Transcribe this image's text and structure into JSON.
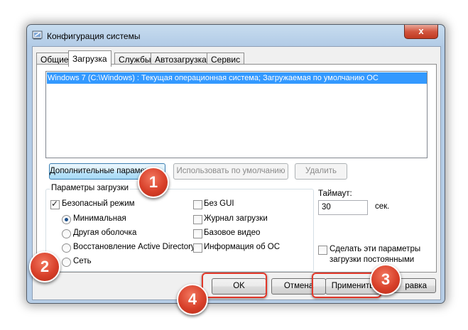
{
  "window": {
    "title": "Конфигурация системы",
    "close": "x"
  },
  "tabs": [
    {
      "label": "Общие"
    },
    {
      "label": "Загрузка"
    },
    {
      "label": "Службы"
    },
    {
      "label": "Автозагрузка"
    },
    {
      "label": "Сервис"
    }
  ],
  "os_list": {
    "entry": "Windows 7 (C:\\Windows) : Текущая операционная система; Загружаемая по умолчанию ОС"
  },
  "buttons": {
    "advanced": "Дополнительные параметры...",
    "set_default": "Использовать по умолчанию",
    "delete": "Удалить",
    "ok": "OK",
    "cancel": "Отмена",
    "apply": "Применить",
    "help_partial": "равка"
  },
  "boot_options": {
    "legend": "Параметры загрузки",
    "safe_mode": "Безопасный режим",
    "radios": [
      "Минимальная",
      "Другая оболочка",
      "Восстановление Active Directory",
      "Сеть"
    ],
    "checks": [
      "Без GUI",
      "Журнал загрузки",
      "Базовое видео",
      "Информация об ОС"
    ]
  },
  "timeout": {
    "label": "Таймаут:",
    "value": "30",
    "unit": "сек."
  },
  "permanent": {
    "line1": "Сделать эти параметры",
    "line2": "загрузки постоянными"
  },
  "badges": [
    "1",
    "2",
    "3",
    "4"
  ],
  "colors": {
    "selection": "#3399ff",
    "annotation": "#e2382a"
  }
}
